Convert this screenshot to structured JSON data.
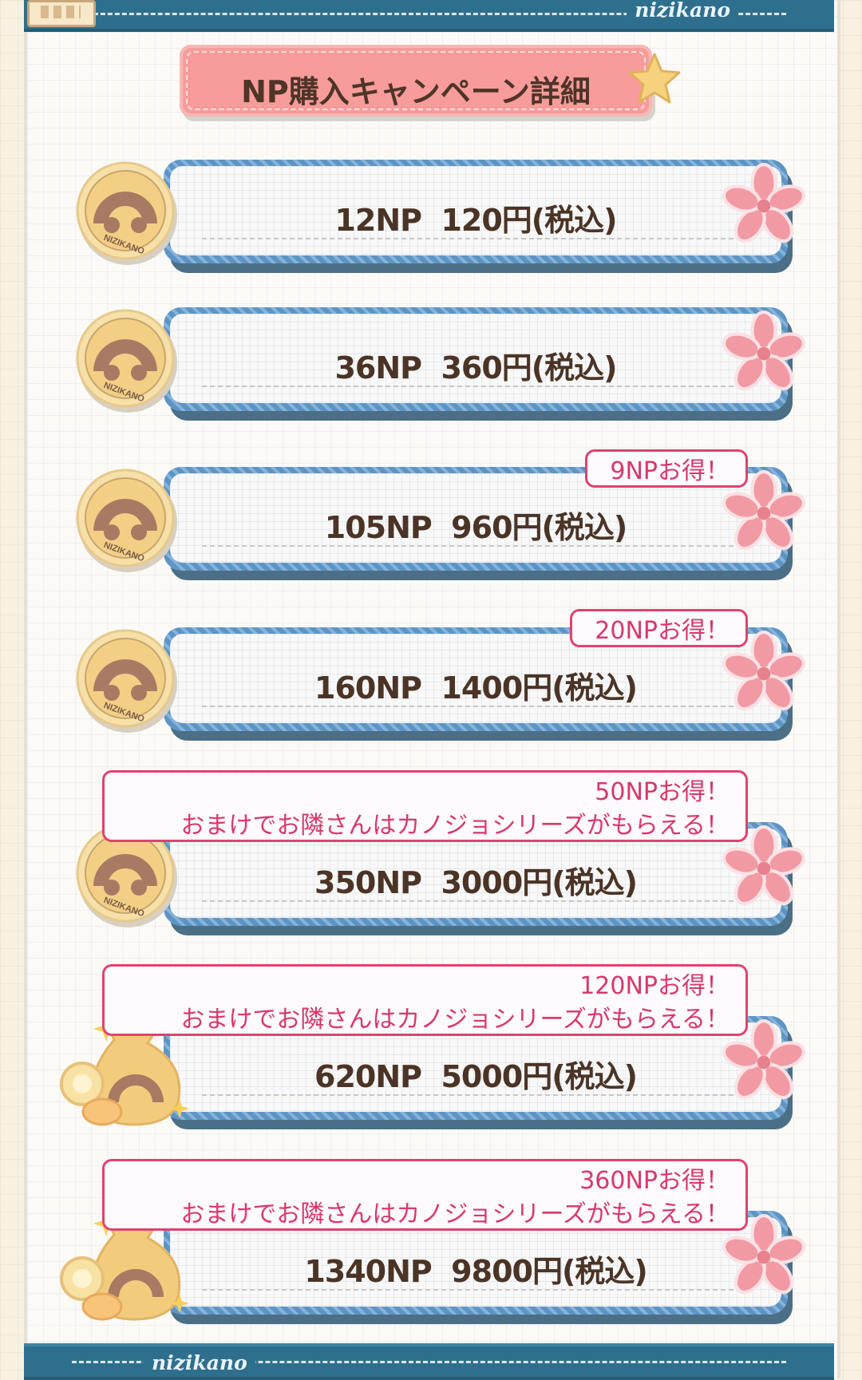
{
  "header": {
    "logo_text": "nizikano"
  },
  "footer": {
    "logo_text": "nizikano"
  },
  "title": "NP購入キャンペーン詳細",
  "colors": {
    "accent_pink": "#f79b9b",
    "badge_pink": "#e0426f",
    "card_blue": "#5e94c4",
    "band_blue": "#2f6f8e"
  },
  "items": [
    {
      "price_label": "12NP  120円(税込)",
      "icon": "nizikano-coin-icon",
      "badge": null
    },
    {
      "price_label": "36NP  360円(税込)",
      "icon": "nizikano-coin-icon",
      "badge": null
    },
    {
      "price_label": "105NP  960円(税込)",
      "icon": "nizikano-coin-icon",
      "badge": {
        "line1": "9NPお得！",
        "line2": null
      }
    },
    {
      "price_label": "160NP  1400円(税込)",
      "icon": "nizikano-coin-icon",
      "badge": {
        "line1": "20NPお得！",
        "line2": null
      }
    },
    {
      "price_label": "350NP  3000円(税込)",
      "icon": "nizikano-coin-icon",
      "badge": {
        "line1": "50NPお得！",
        "line2": "おまけでお隣さんはカノジョシリーズがもらえる！"
      }
    },
    {
      "price_label": "620NP  5000円(税込)",
      "icon": "coin-bag-icon",
      "badge": {
        "line1": "120NPお得！",
        "line2": "おまけでお隣さんはカノジョシリーズがもらえる！"
      }
    },
    {
      "price_label": "1340NP  9800円(税込)",
      "icon": "coin-bag-icon",
      "badge": {
        "line1": "360NPお得！",
        "line2": "おまけでお隣さんはカノジョシリーズがもらえる！"
      }
    }
  ]
}
